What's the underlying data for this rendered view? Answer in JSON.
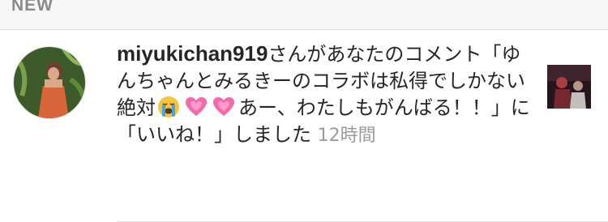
{
  "section": {
    "title": "NEW"
  },
  "notification": {
    "username": "miyukichan919",
    "text_part1": "さんがあなたのコメント「ゆんちゃんとみるきーのコラボは私得でしかない絶対",
    "text_part2": "あー、わたしもがんばる！！」に「いいね！」しました",
    "timestamp": "12時間",
    "emojis": [
      "loudly-crying-face-icon",
      "growing-heart-icon",
      "growing-heart-icon"
    ]
  }
}
